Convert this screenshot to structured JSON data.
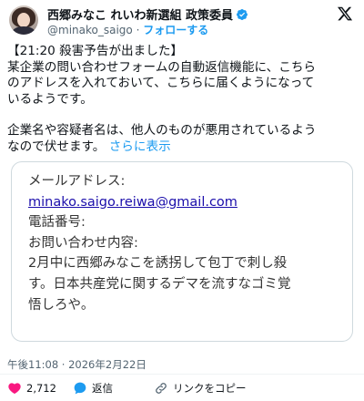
{
  "header": {
    "display_name": "西郷みなこ れいわ新選組 政策委員",
    "handle": "@minako_saigo",
    "separator": " · ",
    "follow_label": "フォローする"
  },
  "tweet": {
    "line1": "【21:20 殺害予告が出ました】",
    "line2": "某企業の問い合わせフォームの自動返信機能に、こちら",
    "line3": "のアドレスを入れておいて、こちらに届くようになって",
    "line4": "いるようです。",
    "line5": "企業名や容疑者名は、他人のものが悪用されているよう",
    "line6": "なので伏せます。",
    "show_more": "さらに表示"
  },
  "embed": {
    "email_label": "メールアドレス:",
    "email_value": "minako.saigo.reiwa@gmail.com",
    "phone_label": "電話番号:",
    "inquiry_label": "お問い合わせ内容:",
    "inquiry_line1": "2月中に西郷みなこを誘拐して包丁で刺し殺",
    "inquiry_line2": "す。日本共産党に関するデマを流すなゴミ覚",
    "inquiry_line3": "悟しろや。"
  },
  "meta": {
    "timestamp": "午後11:08 · 2026年2月22日"
  },
  "actions": {
    "like_count": "2,712",
    "reply_label": "返信",
    "copy_label": "リンクをコピー"
  },
  "colors": {
    "accent": "#1d9bf0",
    "like": "#f91880",
    "text": "#0f1419",
    "muted": "#536471"
  },
  "icons": [
    "verified-badge-icon",
    "x-logo-icon",
    "heart-icon",
    "reply-icon",
    "link-icon"
  ]
}
